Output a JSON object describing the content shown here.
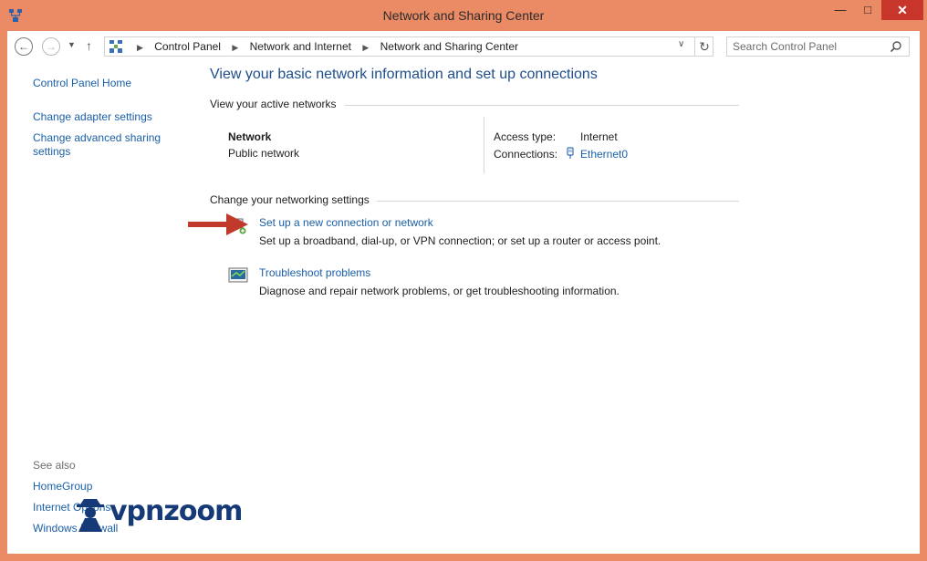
{
  "window": {
    "title": "Network and Sharing Center",
    "minimize_glyph": "—",
    "maximize_glyph": "□",
    "close_glyph": "✕"
  },
  "toolbar": {
    "breadcrumbs": [
      "Control Panel",
      "Network and Internet",
      "Network and Sharing Center"
    ],
    "search_placeholder": "Search Control Panel"
  },
  "sidebar": {
    "home": "Control Panel Home",
    "links": [
      "Change adapter settings",
      "Change advanced sharing settings"
    ],
    "see_also_heading": "See also",
    "see_also": [
      "HomeGroup",
      "Internet Options",
      "Windows Firewall"
    ]
  },
  "main": {
    "heading": "View your basic network information and set up connections",
    "active_networks": {
      "label": "View your active networks",
      "network_name": "Network",
      "network_type": "Public network",
      "access_type_label": "Access type:",
      "access_type_value": "Internet",
      "connections_label": "Connections:",
      "connections_value": "Ethernet0"
    },
    "change_settings": {
      "label": "Change your networking settings",
      "tasks": [
        {
          "link": "Set up a new connection or network",
          "description": "Set up a broadband, dial-up, or VPN connection; or set up a router or access point.",
          "icon": "new-connection-icon"
        },
        {
          "link": "Troubleshoot problems",
          "description": "Diagnose and repair network problems, or get troubleshooting information.",
          "icon": "troubleshoot-icon"
        }
      ]
    }
  },
  "watermark": {
    "text": "vpnzoom"
  },
  "colors": {
    "frame": "#ea8b65",
    "link": "#1a5fa8",
    "heading": "#1e4e8c",
    "close_button": "#c7352b",
    "arrow": "#c0392b"
  }
}
